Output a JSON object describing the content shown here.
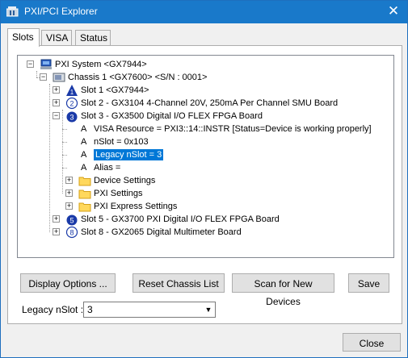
{
  "window": {
    "title": "PXI/PCI Explorer"
  },
  "tabs": [
    {
      "label": "Slots"
    },
    {
      "label": "VISA"
    },
    {
      "label": "Status"
    }
  ],
  "tree": {
    "system": "PXI System <GX7944>",
    "chassis": "Chassis 1 <GX7600> <S/N : 0001>",
    "slot1": {
      "label": "Slot 1 <GX7944>",
      "number": "1"
    },
    "slot2": {
      "label": "Slot 2 - GX3104 4-Channel 20V, 250mA Per Channel SMU Board",
      "number": "2"
    },
    "slot3": {
      "label": "Slot 3 - GX3500 Digital I/O FLEX FPGA Board",
      "number": "3"
    },
    "visa_resource": "VISA Resource = PXI3::14::INSTR [Status=Device is working properly]",
    "nslot": "nSlot = 0x103",
    "legacy_nslot": "Legacy nSlot = 3",
    "alias": "Alias =",
    "device_settings": "Device Settings",
    "pxi_settings": "PXI Settings",
    "pxi_express_settings": "PXI Express Settings",
    "slot5": {
      "label": "Slot 5 - GX3700 PXI Digital I/O FLEX FPGA Board",
      "number": "5"
    },
    "slot8": {
      "label": "Slot 8 - GX2065 Digital Multimeter Board",
      "number": "8"
    }
  },
  "buttons": {
    "display_options": "Display Options ...",
    "reset_chassis": "Reset Chassis List",
    "scan": "Scan for New Devices",
    "save": "Save",
    "close": "Close"
  },
  "legacy_slot": {
    "label": "Legacy nSlot :",
    "value": "3"
  },
  "glyphs": {
    "plus": "+",
    "minus": "−",
    "attr": "A",
    "close": "✕",
    "dropdown": "▼"
  },
  "colors": {
    "title_bar": "#1979ca",
    "selection": "#0078d7",
    "folder": "#ffd85c",
    "slot_badge": "#1a3aa8"
  }
}
